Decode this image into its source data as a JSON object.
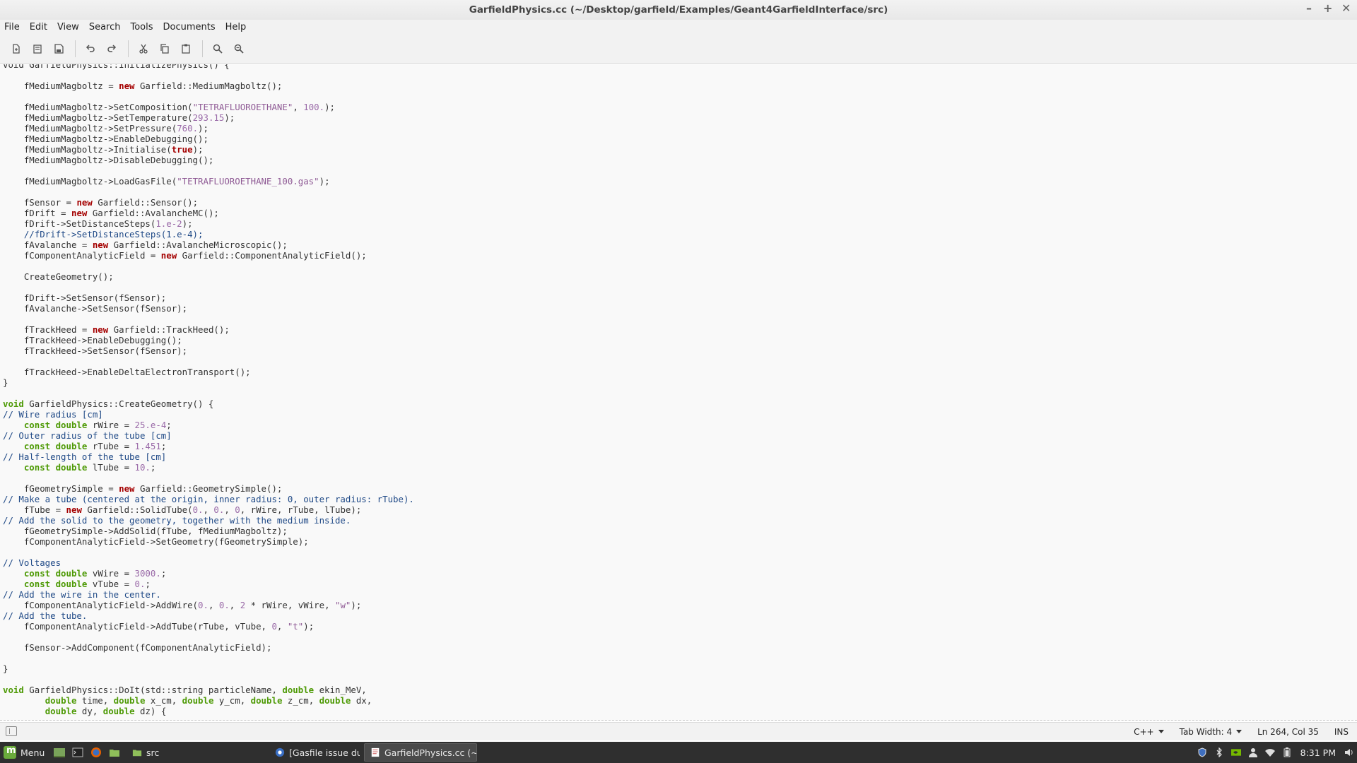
{
  "window": {
    "title": "GarfieldPhysics.cc (~/Desktop/garfield/Examples/Geant4GarfieldInterface/src)",
    "controls": [
      "–",
      "+",
      "✕"
    ]
  },
  "menu": [
    "File",
    "Edit",
    "View",
    "Search",
    "Tools",
    "Documents",
    "Help"
  ],
  "toolbar": {
    "buttons": [
      "new-document",
      "open-document",
      "save-document",
      "undo",
      "redo",
      "cut",
      "copy",
      "paste",
      "find",
      "find-replace"
    ]
  },
  "editor": {
    "lines": [
      [
        [
          "t",
          "void GarfieldPhysics::InitializePhysics() {"
        ]
      ],
      [],
      [
        [
          "t",
          "    fMediumMagboltz = "
        ],
        [
          "kw",
          "new"
        ],
        [
          "t",
          " Garfield::MediumMagboltz();"
        ]
      ],
      [],
      [
        [
          "t",
          "    fMediumMagboltz->SetComposition("
        ],
        [
          "st",
          "\"TETRAFLUOROETHANE\""
        ],
        [
          "t",
          ", "
        ],
        [
          "nm",
          "100."
        ],
        [
          "t",
          ");"
        ]
      ],
      [
        [
          "t",
          "    fMediumMagboltz->SetTemperature("
        ],
        [
          "nm",
          "293.15"
        ],
        [
          "t",
          ");"
        ]
      ],
      [
        [
          "t",
          "    fMediumMagboltz->SetPressure("
        ],
        [
          "nm",
          "760."
        ],
        [
          "t",
          ");"
        ]
      ],
      [
        [
          "t",
          "    fMediumMagboltz->EnableDebugging();"
        ]
      ],
      [
        [
          "t",
          "    fMediumMagboltz->Initialise("
        ],
        [
          "kw",
          "true"
        ],
        [
          "t",
          ");"
        ]
      ],
      [
        [
          "t",
          "    fMediumMagboltz->DisableDebugging();"
        ]
      ],
      [],
      [
        [
          "t",
          "    fMediumMagboltz->LoadGasFile("
        ],
        [
          "st",
          "\"TETRAFLUOROETHANE_100.gas\""
        ],
        [
          "t",
          ");"
        ]
      ],
      [],
      [
        [
          "t",
          "    fSensor = "
        ],
        [
          "kw",
          "new"
        ],
        [
          "t",
          " Garfield::Sensor();"
        ]
      ],
      [
        [
          "t",
          "    fDrift = "
        ],
        [
          "kw",
          "new"
        ],
        [
          "t",
          " Garfield::AvalancheMC();"
        ]
      ],
      [
        [
          "t",
          "    fDrift->SetDistanceSteps("
        ],
        [
          "nm",
          "1.e-2"
        ],
        [
          "t",
          ");"
        ]
      ],
      [
        [
          "cm",
          "    //fDrift->SetDistanceSteps(1.e-4);"
        ]
      ],
      [
        [
          "t",
          "    fAvalanche = "
        ],
        [
          "kw",
          "new"
        ],
        [
          "t",
          " Garfield::AvalancheMicroscopic();"
        ]
      ],
      [
        [
          "t",
          "    fComponentAnalyticField = "
        ],
        [
          "kw",
          "new"
        ],
        [
          "t",
          " Garfield::ComponentAnalyticField();"
        ]
      ],
      [],
      [
        [
          "t",
          "    CreateGeometry();"
        ]
      ],
      [],
      [
        [
          "t",
          "    fDrift->SetSensor(fSensor);"
        ]
      ],
      [
        [
          "t",
          "    fAvalanche->SetSensor(fSensor);"
        ]
      ],
      [],
      [
        [
          "t",
          "    fTrackHeed = "
        ],
        [
          "kw",
          "new"
        ],
        [
          "t",
          " Garfield::TrackHeed();"
        ]
      ],
      [
        [
          "t",
          "    fTrackHeed->EnableDebugging();"
        ]
      ],
      [
        [
          "t",
          "    fTrackHeed->SetSensor(fSensor);"
        ]
      ],
      [],
      [
        [
          "t",
          "    fTrackHeed->EnableDeltaElectronTransport();"
        ]
      ],
      [
        [
          "t",
          "}"
        ]
      ],
      [],
      [
        [
          "ty",
          "void"
        ],
        [
          "t",
          " GarfieldPhysics::CreateGeometry() {"
        ]
      ],
      [
        [
          "cm",
          "// Wire radius [cm]"
        ]
      ],
      [
        [
          "t",
          "    "
        ],
        [
          "ty",
          "const double"
        ],
        [
          "t",
          " rWire = "
        ],
        [
          "nm",
          "25.e-4"
        ],
        [
          "t",
          ";"
        ]
      ],
      [
        [
          "cm",
          "// Outer radius of the tube [cm]"
        ]
      ],
      [
        [
          "t",
          "    "
        ],
        [
          "ty",
          "const double"
        ],
        [
          "t",
          " rTube = "
        ],
        [
          "nm",
          "1.451"
        ],
        [
          "t",
          ";"
        ]
      ],
      [
        [
          "cm",
          "// Half-length of the tube [cm]"
        ]
      ],
      [
        [
          "t",
          "    "
        ],
        [
          "ty",
          "const double"
        ],
        [
          "t",
          " lTube = "
        ],
        [
          "nm",
          "10."
        ],
        [
          "t",
          ";"
        ]
      ],
      [],
      [
        [
          "t",
          "    fGeometrySimple = "
        ],
        [
          "kw",
          "new"
        ],
        [
          "t",
          " Garfield::GeometrySimple();"
        ]
      ],
      [
        [
          "cm",
          "// Make a tube (centered at the origin, inner radius: 0, outer radius: rTube)."
        ]
      ],
      [
        [
          "t",
          "    fTube = "
        ],
        [
          "kw",
          "new"
        ],
        [
          "t",
          " Garfield::SolidTube("
        ],
        [
          "nm",
          "0."
        ],
        [
          "t",
          ", "
        ],
        [
          "nm",
          "0."
        ],
        [
          "t",
          ", "
        ],
        [
          "nm",
          "0"
        ],
        [
          "t",
          ", rWire, rTube, lTube);"
        ]
      ],
      [
        [
          "cm",
          "// Add the solid to the geometry, together with the medium inside."
        ]
      ],
      [
        [
          "t",
          "    fGeometrySimple->AddSolid(fTube, fMediumMagboltz);"
        ]
      ],
      [
        [
          "t",
          "    fComponentAnalyticField->SetGeometry(fGeometrySimple);"
        ]
      ],
      [],
      [
        [
          "cm",
          "// Voltages"
        ]
      ],
      [
        [
          "t",
          "    "
        ],
        [
          "ty",
          "const double"
        ],
        [
          "t",
          " vWire = "
        ],
        [
          "nm",
          "3000."
        ],
        [
          "t",
          ";"
        ]
      ],
      [
        [
          "t",
          "    "
        ],
        [
          "ty",
          "const double"
        ],
        [
          "t",
          " vTube = "
        ],
        [
          "nm",
          "0."
        ],
        [
          "t",
          ";"
        ]
      ],
      [
        [
          "cm",
          "// Add the wire in the center."
        ]
      ],
      [
        [
          "t",
          "    fComponentAnalyticField->AddWire("
        ],
        [
          "nm",
          "0."
        ],
        [
          "t",
          ", "
        ],
        [
          "nm",
          "0."
        ],
        [
          "t",
          ", "
        ],
        [
          "nm",
          "2"
        ],
        [
          "t",
          " * rWire, vWire, "
        ],
        [
          "st",
          "\"w\""
        ],
        [
          "t",
          ");"
        ]
      ],
      [
        [
          "cm",
          "// Add the tube."
        ]
      ],
      [
        [
          "t",
          "    fComponentAnalyticField->AddTube(rTube, vTube, "
        ],
        [
          "nm",
          "0"
        ],
        [
          "t",
          ", "
        ],
        [
          "st",
          "\"t\""
        ],
        [
          "t",
          ");"
        ]
      ],
      [],
      [
        [
          "t",
          "    fSensor->AddComponent(fComponentAnalyticField);"
        ]
      ],
      [],
      [
        [
          "t",
          "}"
        ]
      ],
      [],
      [
        [
          "ty",
          "void"
        ],
        [
          "t",
          " GarfieldPhysics::DoIt(std::string particleName, "
        ],
        [
          "ty",
          "double"
        ],
        [
          "t",
          " ekin_MeV,"
        ]
      ],
      [
        [
          "t",
          "        "
        ],
        [
          "ty",
          "double"
        ],
        [
          "t",
          " time, "
        ],
        [
          "ty",
          "double"
        ],
        [
          "t",
          " x_cm, "
        ],
        [
          "ty",
          "double"
        ],
        [
          "t",
          " y_cm, "
        ],
        [
          "ty",
          "double"
        ],
        [
          "t",
          " z_cm, "
        ],
        [
          "ty",
          "double"
        ],
        [
          "t",
          " dx,"
        ]
      ],
      [
        [
          "t",
          "        "
        ],
        [
          "ty",
          "double"
        ],
        [
          "t",
          " dy, "
        ],
        [
          "ty",
          "double"
        ],
        [
          "t",
          " dz) {"
        ]
      ]
    ]
  },
  "statusbar": {
    "language": "C++",
    "tab_width": "Tab Width:  4",
    "position": "Ln 264, Col 35",
    "mode": "INS"
  },
  "taskbar": {
    "menu_label": "Menu",
    "folder_label": "src",
    "windows": [
      {
        "label": "[Gasfile issue during...",
        "active": false
      },
      {
        "label": "GarfieldPhysics.cc (~...",
        "active": true
      }
    ],
    "clock": "8:31 PM"
  },
  "colors": {
    "keyword": "#a40000",
    "type": "#4e9a06",
    "string": "#8f5a95",
    "comment": "#204a87"
  }
}
